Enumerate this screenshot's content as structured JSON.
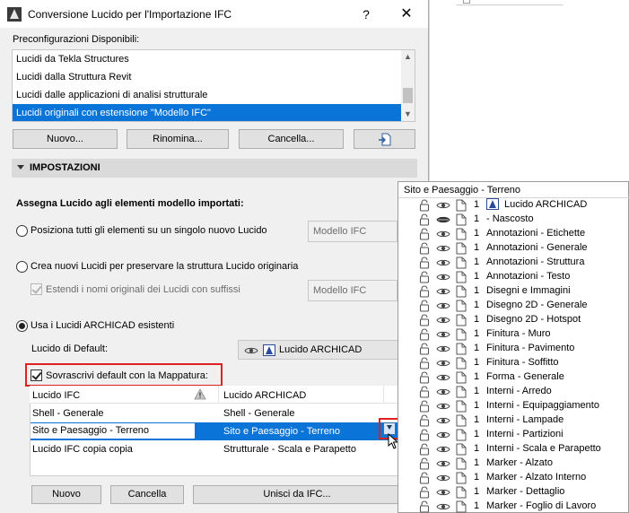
{
  "window": {
    "title": "Conversione Lucido per l'Importazione IFC",
    "help": "?",
    "close": "✕"
  },
  "presets": {
    "label": "Preconfigurazioni Disponibili:",
    "items": [
      "Lucidi da Tekla Structures",
      "Lucidi dalla Struttura Revit",
      "Lucidi dalle applicazioni di analisi strutturale",
      "Lucidi originali con estensione \"Modello IFC\""
    ],
    "selected_index": 3,
    "buttons": {
      "new": "Nuovo...",
      "rename": "Rinomina...",
      "delete": "Cancella..."
    }
  },
  "settings": {
    "section_title": "IMPOSTAZIONI",
    "assign_label": "Assegna Lucido agli elementi modello importati:",
    "option1": "Posiziona tutti gli elementi su un singolo nuovo Lucido",
    "option1_field": "Modello IFC",
    "option2": "Crea nuovi Lucidi per preservare la struttura Lucido originaria",
    "option2_sub": "Estendi i nomi originali dei Lucidi con suffissi",
    "option2_field": "Modello IFC",
    "option3": "Usa i Lucidi ARCHICAD esistenti",
    "selected_option": 3,
    "default_label": "Lucido di Default:",
    "default_value": "Lucido ARCHICAD",
    "overwrite_label": "Sovrascrivi default con la Mappatura:",
    "overwrite_checked": true
  },
  "mapping": {
    "headers": [
      "Lucido IFC",
      "Lucido ARCHICAD"
    ],
    "rows": [
      {
        "ifc": "Shell - Generale",
        "archicad": "Shell - Generale"
      },
      {
        "ifc": "Sito e Paesaggio - Terreno",
        "archicad": "Sito e Paesaggio - Terreno",
        "selected": true
      },
      {
        "ifc": "Lucido IFC copia copia",
        "archicad": "Strutturale - Scala e Parapetto"
      }
    ]
  },
  "bottom_buttons": {
    "new": "Nuovo",
    "delete": "Cancella",
    "merge": "Unisci da IFC..."
  },
  "popup": {
    "title": "Sito e Paesaggio - Terreno",
    "items": [
      {
        "num": "1",
        "name": "Lucido ARCHICAD",
        "icon": "archicad-layer-icon"
      },
      {
        "num": "1",
        "name": "- Nascosto",
        "hidden": true
      },
      {
        "num": "1",
        "name": "Annotazioni - Etichette"
      },
      {
        "num": "1",
        "name": "Annotazioni - Generale"
      },
      {
        "num": "1",
        "name": "Annotazioni - Struttura"
      },
      {
        "num": "1",
        "name": "Annotazioni - Testo"
      },
      {
        "num": "1",
        "name": "Disegni e Immagini"
      },
      {
        "num": "1",
        "name": "Disegno 2D - Generale"
      },
      {
        "num": "1",
        "name": "Disegno 2D - Hotspot"
      },
      {
        "num": "1",
        "name": "Finitura - Muro"
      },
      {
        "num": "1",
        "name": "Finitura - Pavimento"
      },
      {
        "num": "1",
        "name": "Finitura - Soffitto"
      },
      {
        "num": "1",
        "name": "Forma - Generale"
      },
      {
        "num": "1",
        "name": "Interni - Arredo"
      },
      {
        "num": "1",
        "name": "Interni - Equipaggiamento"
      },
      {
        "num": "1",
        "name": "Interni - Lampade"
      },
      {
        "num": "1",
        "name": "Interni - Partizioni"
      },
      {
        "num": "1",
        "name": "Interni - Scala e Parapetto"
      },
      {
        "num": "1",
        "name": "Marker - Alzato"
      },
      {
        "num": "1",
        "name": "Marker - Alzato Interno"
      },
      {
        "num": "1",
        "name": "Marker - Dettaglio"
      },
      {
        "num": "1",
        "name": "Marker - Foglio di Lavoro"
      }
    ]
  },
  "colors": {
    "selection": "#0a74d9",
    "highlight": "#e02020",
    "dialog_bg": "#f0f0f0"
  }
}
